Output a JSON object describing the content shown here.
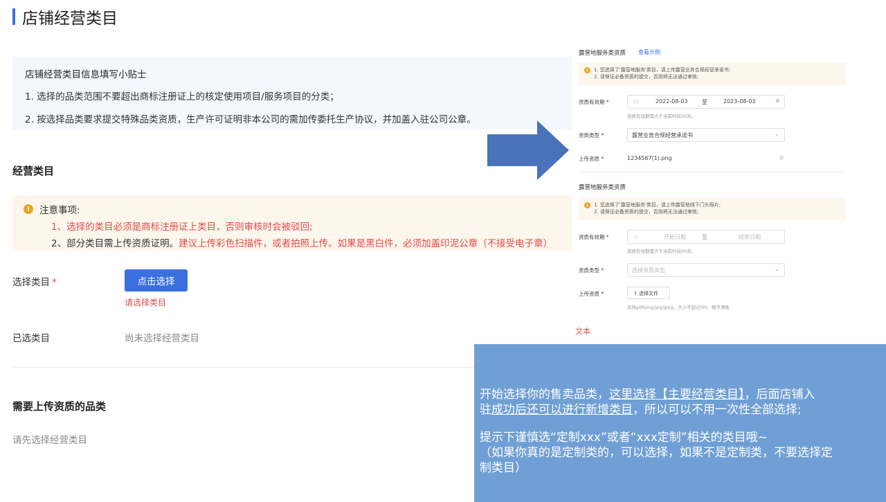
{
  "header": {
    "title": "店铺经营类目"
  },
  "tips": {
    "title": "店铺经营类目信息填写小贴士",
    "line1": "1. 选择的品类范围不要超出商标注册证上的核定使用项目/服务项目的分类；",
    "line2": "2. 按选择品类要求提交特殊品类资质，生产许可证明非本公司的需加传委托生产协议，并加盖入驻公司公章。"
  },
  "category_section": {
    "heading": "经营类目",
    "notice_title": "注意事项:",
    "notice_line1": "1、选择的类目必须是商标注册证上类目，否则审核时会被驳回;",
    "notice_line2a": "2、部分类目需上传资质证明。",
    "notice_line2b": "建议上传彩色扫描件，或者拍照上传。如果是黑白件，必须加盖印泥公章（不接受电子章）",
    "select_label": "选择类目",
    "required_mark": "*",
    "select_button": "点击选择",
    "select_error": "请选择类目",
    "selected_label": "已选类目",
    "selected_empty": "尚未选择经营类目"
  },
  "qualification_section": {
    "heading": "需要上传资质的品类",
    "empty_text": "请先选择经营类目"
  },
  "right_panel": {
    "block1": {
      "title": "露营地服务类资质",
      "link": "查看示例",
      "warn1": "1. 您选择了'露营地服务'类目，请上传露营业务合规经营承诺书;",
      "warn2": "2. 请保证必备资质的提交，否则将无法通过审核;",
      "validity_label": "资质有效期 *",
      "date_start": "2022-08-03",
      "date_to": "至",
      "date_end": "2023-08-03",
      "validity_hint": "资质有效期需大于当前时间30天。",
      "type_label": "资质类型 *",
      "type_value": "露营业务合规经营承诺书",
      "upload_label": "上传资质 *",
      "upload_file": "1234567(1).png"
    },
    "block2": {
      "title": "露营地服务类资质",
      "warn1": "1. 您选择了'露营地服务'类目，请上传露营地线下门头照片;",
      "warn2": "2. 请保证必备资质的提交，否则将无法通过审核;",
      "validity_label": "资质有效期 *",
      "date_start_ph": "开始日期",
      "date_to": "至",
      "date_end_ph": "结束日期",
      "validity_hint": "资质有效期需大于当前时间30天。",
      "type_label": "资质类型 *",
      "type_ph": "选择资质类型",
      "upload_label": "上传资质 *",
      "upload_button": "选择文件",
      "upload_hint": "支持pdf/png/jpg/jpeg，大小不超过5M，细节清晰"
    }
  },
  "note_text": "文本",
  "overlay": {
    "line1a": "开始选择你的售卖品类，",
    "line1b": "这里选择【主要经营类目】",
    "line1c": "，后面店铺入",
    "line2a": "驻",
    "line2b": "成功后还可以进行新增类目",
    "line2c": "，所以可以不用一次性全部选择;",
    "line3": "提示下谨慎选“定制xxx”或者“xxx定制”相关的类目哦~",
    "line4": "（如果你真的是定制类的，可以选择，如果不是定制类，不要选择定",
    "line5": "制类目）"
  },
  "colors": {
    "accent": "#3b6fe0",
    "error": "#e14b4b",
    "overlay": "#6f9fd4",
    "notice_bg": "#fdf6ec",
    "tips_bg": "#f4f7fd",
    "arrow": "#4a72b8"
  }
}
